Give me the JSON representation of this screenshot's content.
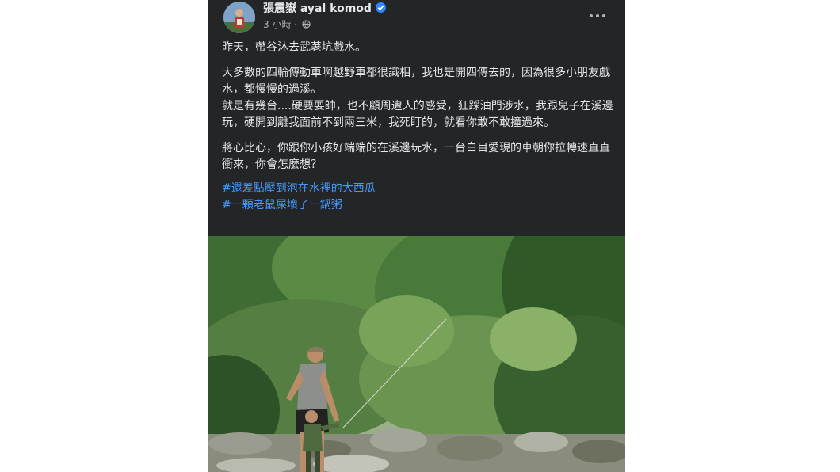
{
  "post": {
    "author": "張震嶽 ayal komod",
    "time": "3 小時",
    "separator": "·",
    "icons": {
      "verified": "verified-badge-icon",
      "audience": "globe-icon",
      "more": "more-options-icon"
    },
    "paragraphs": [
      "昨天，帶谷沐去武荖坑戲水。",
      "大多數的四輪傳動車啊越野車都很識相，我也是開四傳去的，因為很多小朋友戲水，都慢慢的過溪。",
      "就是有幾台....硬要耍帥，也不顧周遭人的感受，狂踩油門涉水，我跟兒子在溪邊玩，硬開到離我面前不到兩三米，我死盯的，就看你敢不敢撞過來。",
      "將心比心，你跟你小孩好端端的在溪邊玩水，一台白目愛現的車朝你拉轉速直直衝來，你會怎麼想？"
    ],
    "hashtags": [
      "#還差點壓到泡在水裡的大西瓜",
      "#一顆老鼠屎壞了一鍋粥"
    ]
  },
  "colors": {
    "card": "#242526",
    "text": "#e4e6eb",
    "secondary": "#b0b3b8",
    "link": "#4599ff",
    "verified": "#2d88ff"
  }
}
